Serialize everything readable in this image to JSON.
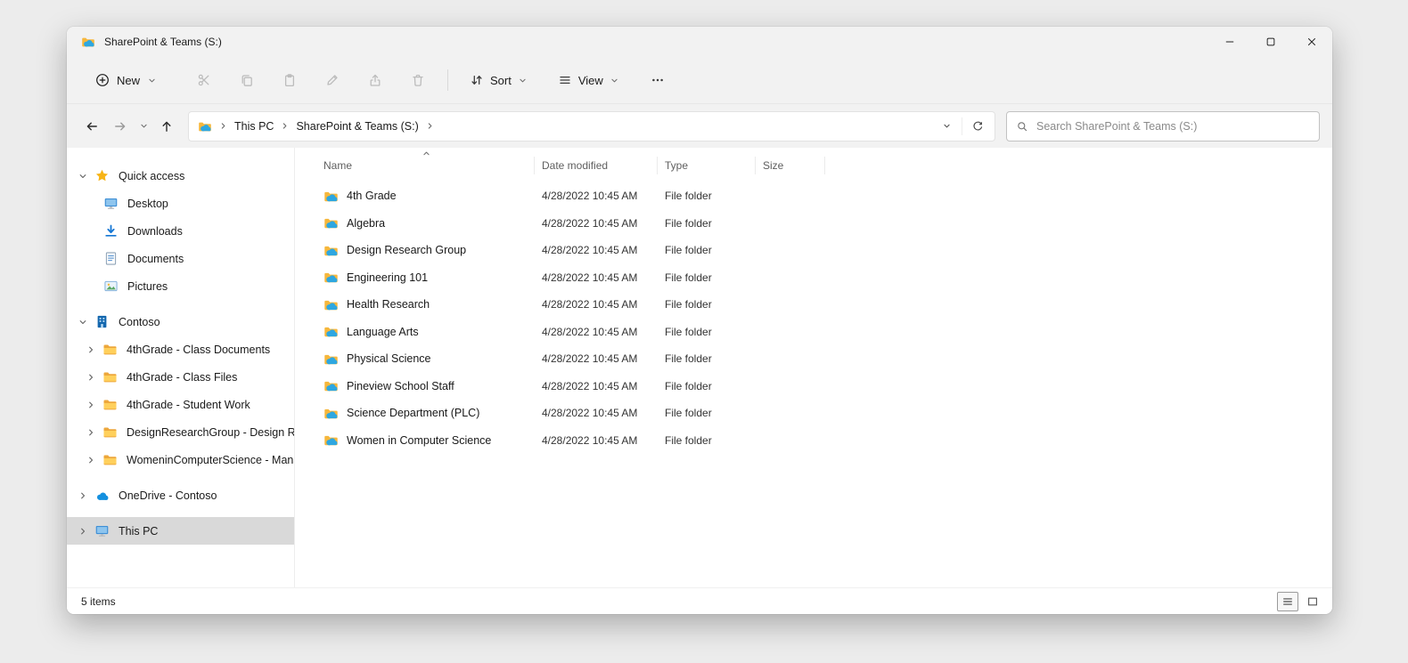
{
  "window": {
    "title": "SharePoint & Teams (S:)"
  },
  "toolbar": {
    "new_label": "New",
    "sort_label": "Sort",
    "view_label": "View"
  },
  "address": {
    "crumbs": [
      "This PC",
      "SharePoint & Teams (S:)"
    ],
    "search_placeholder": "Search SharePoint & Teams (S:)"
  },
  "sidebar": {
    "quick_access": {
      "label": "Quick access",
      "items": [
        "Desktop",
        "Downloads",
        "Documents",
        "Pictures"
      ]
    },
    "contoso": {
      "label": "Contoso",
      "items": [
        "4thGrade - Class Documents",
        "4thGrade - Class Files",
        "4thGrade - Student Work",
        "DesignResearchGroup - Design Resea",
        "WomeninComputerScience - Manage"
      ]
    },
    "onedrive": {
      "label": "OneDrive - Contoso"
    },
    "this_pc": {
      "label": "This PC"
    }
  },
  "filelist": {
    "columns": [
      "Name",
      "Date modified",
      "Type",
      "Size"
    ],
    "rows": [
      {
        "name": "4th Grade",
        "date": "4/28/2022 10:45 AM",
        "type": "File folder"
      },
      {
        "name": "Algebra",
        "date": "4/28/2022 10:45 AM",
        "type": "File folder"
      },
      {
        "name": "Design Research Group",
        "date": "4/28/2022 10:45 AM",
        "type": "File folder"
      },
      {
        "name": "Engineering 101",
        "date": "4/28/2022 10:45 AM",
        "type": "File folder"
      },
      {
        "name": "Health Research",
        "date": "4/28/2022 10:45 AM",
        "type": "File folder"
      },
      {
        "name": "Language Arts",
        "date": "4/28/2022 10:45 AM",
        "type": "File folder"
      },
      {
        "name": "Physical Science",
        "date": "4/28/2022 10:45 AM",
        "type": "File folder"
      },
      {
        "name": "Pineview School Staff",
        "date": "4/28/2022 10:45 AM",
        "type": "File folder"
      },
      {
        "name": "Science Department (PLC)",
        "date": "4/28/2022 10:45 AM",
        "type": "File folder"
      },
      {
        "name": "Women in Computer Science",
        "date": "4/28/2022 10:45 AM",
        "type": "File folder"
      }
    ]
  },
  "status": {
    "items_text": "5 items"
  },
  "colors": {
    "accent": "#0f6cbd",
    "cloud": "#28a8ea",
    "folder": "#ffc843",
    "selection": "#d9d9d9"
  }
}
